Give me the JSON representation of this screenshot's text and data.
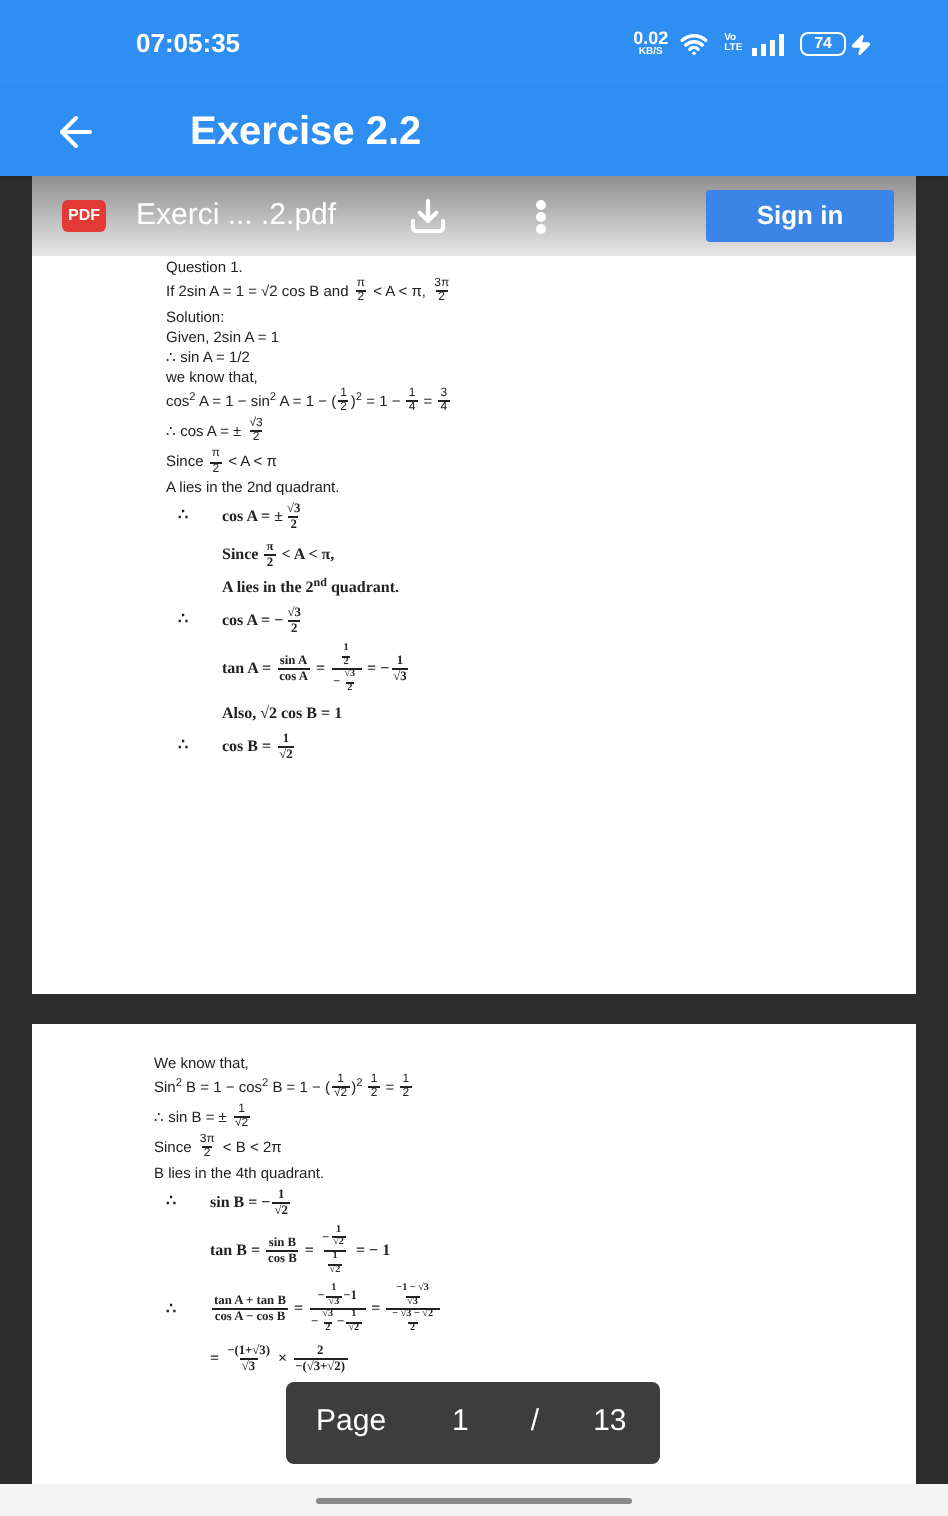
{
  "status_bar": {
    "time": "07:05:35",
    "speed": "0.02",
    "speed_unit": "KB/S",
    "network": "Vo LTE",
    "battery": "74",
    "charging": true
  },
  "app_bar": {
    "back": true,
    "title": "Exercise 2.2"
  },
  "viewer_toolbar": {
    "file_badge": "PDF",
    "file_name": "Exerci ... .2.pdf",
    "sign_in": "Sign in"
  },
  "pages": [
    {
      "lines": [
        {
          "kind": "sans",
          "parts": [
            {
              "kind": "text",
              "t": "Question 1."
            }
          ]
        },
        {
          "kind": "sans",
          "parts": [
            {
              "kind": "text",
              "t": "If 2sin A = 1 = √2 cos B and "
            },
            {
              "kind": "frac",
              "n": [
                {
                  "kind": "text",
                  "t": "π"
                }
              ],
              "d": [
                {
                  "kind": "text",
                  "t": "2"
                }
              ]
            },
            {
              "kind": "text",
              "t": " < A < π, "
            },
            {
              "kind": "frac",
              "n": [
                {
                  "kind": "text",
                  "t": "3π"
                }
              ],
              "d": [
                {
                  "kind": "text",
                  "t": "2"
                }
              ]
            }
          ]
        },
        {
          "kind": "sans",
          "parts": [
            {
              "kind": "text",
              "t": "Solution:"
            }
          ]
        },
        {
          "kind": "sans",
          "parts": [
            {
              "kind": "text",
              "t": "Given, 2sin A = 1"
            }
          ]
        },
        {
          "kind": "sans",
          "parts": [
            {
              "kind": "text",
              "t": "∴ sin A = 1/2"
            }
          ]
        },
        {
          "kind": "sans",
          "parts": [
            {
              "kind": "text",
              "t": "we know that,"
            }
          ]
        },
        {
          "kind": "sans",
          "parts": [
            {
              "kind": "text",
              "t": "cos$^{2}$ A = 1 − sin$^{2}$ A = 1 − ("
            },
            {
              "kind": "frac",
              "n": [
                {
                  "kind": "text",
                  "t": "1"
                }
              ],
              "d": [
                {
                  "kind": "text",
                  "t": "2"
                }
              ]
            },
            {
              "kind": "text",
              "t": ")$^{2}$ = 1 − "
            },
            {
              "kind": "frac",
              "n": [
                {
                  "kind": "text",
                  "t": "1"
                }
              ],
              "d": [
                {
                  "kind": "text",
                  "t": "4"
                }
              ]
            },
            {
              "kind": "text",
              "t": " = "
            },
            {
              "kind": "frac",
              "n": [
                {
                  "kind": "text",
                  "t": "3"
                }
              ],
              "d": [
                {
                  "kind": "text",
                  "t": "4"
                }
              ]
            }
          ]
        },
        {
          "kind": "sans",
          "parts": [
            {
              "kind": "text",
              "t": "∴ cos A = ± "
            },
            {
              "kind": "frac",
              "n": [
                {
                  "kind": "text",
                  "t": "√3"
                }
              ],
              "d": [
                {
                  "kind": "text",
                  "t": "2"
                }
              ]
            }
          ]
        },
        {
          "kind": "sans",
          "parts": [
            {
              "kind": "text",
              "t": "Since "
            },
            {
              "kind": "frac",
              "n": [
                {
                  "kind": "text",
                  "t": "π"
                }
              ],
              "d": [
                {
                  "kind": "text",
                  "t": "2"
                }
              ]
            },
            {
              "kind": "text",
              "t": " < A < π"
            }
          ]
        },
        {
          "kind": "sans",
          "parts": [
            {
              "kind": "text",
              "t": "A lies in the 2nd quadrant."
            }
          ]
        },
        {
          "kind": "serif",
          "therefore": "∴",
          "parts": [
            {
              "kind": "text",
              "t": "cos A = ±"
            },
            {
              "kind": "frac",
              "n": [
                {
                  "kind": "text",
                  "t": "√3"
                }
              ],
              "d": [
                {
                  "kind": "text",
                  "t": "2"
                }
              ]
            }
          ]
        },
        {
          "kind": "serif",
          "parts": [
            {
              "kind": "text",
              "t": "Since "
            },
            {
              "kind": "frac",
              "n": [
                {
                  "kind": "text",
                  "t": "π"
                }
              ],
              "d": [
                {
                  "kind": "text",
                  "t": "2"
                }
              ]
            },
            {
              "kind": "text",
              "t": " < A < π,"
            }
          ]
        },
        {
          "kind": "serif",
          "parts": [
            {
              "kind": "text",
              "t": "A lies in the 2$^{nd}$ quadrant."
            }
          ]
        },
        {
          "kind": "serif",
          "therefore": "∴",
          "parts": [
            {
              "kind": "text",
              "t": "cos A = −"
            },
            {
              "kind": "frac",
              "n": [
                {
                  "kind": "text",
                  "t": "√3"
                }
              ],
              "d": [
                {
                  "kind": "text",
                  "t": "2"
                }
              ]
            }
          ]
        },
        {
          "kind": "serif",
          "parts": [
            {
              "kind": "text",
              "t": "tan A = "
            },
            {
              "kind": "frac",
              "n": [
                {
                  "kind": "text",
                  "t": "sin A"
                }
              ],
              "d": [
                {
                  "kind": "text",
                  "t": "cos A"
                }
              ]
            },
            {
              "kind": "text",
              "t": " = "
            },
            {
              "kind": "frac",
              "n": [
                {
                  "kind": "frac",
                  "n": [
                    {
                      "kind": "text",
                      "t": "1"
                    }
                  ],
                  "d": [
                    {
                      "kind": "text",
                      "t": "2"
                    }
                  ]
                }
              ],
              "d": [
                {
                  "kind": "text",
                  "t": "−"
                },
                {
                  "kind": "frac",
                  "n": [
                    {
                      "kind": "text",
                      "t": "√3"
                    }
                  ],
                  "d": [
                    {
                      "kind": "text",
                      "t": "2"
                    }
                  ]
                }
              ]
            },
            {
              "kind": "text",
              "t": " = −"
            },
            {
              "kind": "frac",
              "n": [
                {
                  "kind": "text",
                  "t": "1"
                }
              ],
              "d": [
                {
                  "kind": "text",
                  "t": "√3"
                }
              ]
            }
          ]
        },
        {
          "kind": "serif",
          "parts": [
            {
              "kind": "text",
              "t": "Also, √2 cos B = 1"
            }
          ]
        },
        {
          "kind": "serif",
          "therefore": "∴",
          "parts": [
            {
              "kind": "text",
              "t": "cos B = "
            },
            {
              "kind": "frac",
              "n": [
                {
                  "kind": "text",
                  "t": "1"
                }
              ],
              "d": [
                {
                  "kind": "text",
                  "t": "√2"
                }
              ]
            }
          ]
        }
      ]
    },
    {
      "lines": [
        {
          "kind": "sans",
          "parts": [
            {
              "kind": "text",
              "t": "We know that,"
            }
          ]
        },
        {
          "kind": "sans",
          "parts": [
            {
              "kind": "text",
              "t": "Sin$^{2}$ B = 1 − cos$^{2}$ B = 1 − ("
            },
            {
              "kind": "frac",
              "n": [
                {
                  "kind": "text",
                  "t": "1"
                }
              ],
              "d": [
                {
                  "kind": "text",
                  "t": "√2"
                }
              ]
            },
            {
              "kind": "text",
              "t": ")$^{2}$ "
            },
            {
              "kind": "frac",
              "n": [
                {
                  "kind": "text",
                  "t": "1"
                }
              ],
              "d": [
                {
                  "kind": "text",
                  "t": "2"
                }
              ]
            },
            {
              "kind": "text",
              "t": " = "
            },
            {
              "kind": "frac",
              "n": [
                {
                  "kind": "text",
                  "t": "1"
                }
              ],
              "d": [
                {
                  "kind": "text",
                  "t": "2"
                }
              ]
            }
          ]
        },
        {
          "kind": "sans",
          "parts": [
            {
              "kind": "text",
              "t": "∴ sin B = ± "
            },
            {
              "kind": "frac",
              "n": [
                {
                  "kind": "text",
                  "t": "1"
                }
              ],
              "d": [
                {
                  "kind": "text",
                  "t": "√2"
                }
              ]
            }
          ]
        },
        {
          "kind": "sans",
          "parts": [
            {
              "kind": "text",
              "t": "Since "
            },
            {
              "kind": "frac",
              "n": [
                {
                  "kind": "text",
                  "t": "3π"
                }
              ],
              "d": [
                {
                  "kind": "text",
                  "t": "2"
                }
              ]
            },
            {
              "kind": "text",
              "t": " < B < 2π"
            }
          ]
        },
        {
          "kind": "sans",
          "parts": [
            {
              "kind": "text",
              "t": "B lies in the 4th quadrant."
            }
          ]
        },
        {
          "kind": "serif",
          "therefore": "∴",
          "parts": [
            {
              "kind": "text",
              "t": "sin B = −"
            },
            {
              "kind": "frac",
              "n": [
                {
                  "kind": "text",
                  "t": "1"
                }
              ],
              "d": [
                {
                  "kind": "text",
                  "t": "√2"
                }
              ]
            }
          ]
        },
        {
          "kind": "serif",
          "parts": [
            {
              "kind": "text",
              "t": "tan B = "
            },
            {
              "kind": "frac",
              "n": [
                {
                  "kind": "text",
                  "t": "sin B"
                }
              ],
              "d": [
                {
                  "kind": "text",
                  "t": "cos B"
                }
              ]
            },
            {
              "kind": "text",
              "t": " = "
            },
            {
              "kind": "frac",
              "n": [
                {
                  "kind": "text",
                  "t": "−"
                },
                {
                  "kind": "frac",
                  "n": [
                    {
                      "kind": "text",
                      "t": "1"
                    }
                  ],
                  "d": [
                    {
                      "kind": "text",
                      "t": "√2"
                    }
                  ]
                }
              ],
              "d": [
                {
                  "kind": "frac",
                  "n": [
                    {
                      "kind": "text",
                      "t": "1"
                    }
                  ],
                  "d": [
                    {
                      "kind": "text",
                      "t": "√2"
                    }
                  ]
                }
              ]
            },
            {
              "kind": "text",
              "t": " = − 1"
            }
          ]
        },
        {
          "kind": "serif",
          "therefore": "∴",
          "parts": [
            {
              "kind": "frac",
              "n": [
                {
                  "kind": "text",
                  "t": "tan A + tan B"
                }
              ],
              "d": [
                {
                  "kind": "text",
                  "t": "cos A − cos B"
                }
              ]
            },
            {
              "kind": "text",
              "t": " = "
            },
            {
              "kind": "frac",
              "n": [
                {
                  "kind": "text",
                  "t": "−"
                },
                {
                  "kind": "frac",
                  "n": [
                    {
                      "kind": "text",
                      "t": "1"
                    }
                  ],
                  "d": [
                    {
                      "kind": "text",
                      "t": "√3"
                    }
                  ]
                },
                {
                  "kind": "text",
                  "t": "−1"
                }
              ],
              "d": [
                {
                  "kind": "text",
                  "t": "−"
                },
                {
                  "kind": "frac",
                  "n": [
                    {
                      "kind": "text",
                      "t": "√3"
                    }
                  ],
                  "d": [
                    {
                      "kind": "text",
                      "t": "2"
                    }
                  ]
                },
                {
                  "kind": "text",
                  "t": "−"
                },
                {
                  "kind": "frac",
                  "n": [
                    {
                      "kind": "text",
                      "t": "1"
                    }
                  ],
                  "d": [
                    {
                      "kind": "text",
                      "t": "√2"
                    }
                  ]
                }
              ]
            },
            {
              "kind": "text",
              "t": " = "
            },
            {
              "kind": "frac",
              "n": [
                {
                  "kind": "frac",
                  "n": [
                    {
                      "kind": "text",
                      "t": "−1 − √3"
                    }
                  ],
                  "d": [
                    {
                      "kind": "text",
                      "t": "√3"
                    }
                  ]
                }
              ],
              "d": [
                {
                  "kind": "frac",
                  "n": [
                    {
                      "kind": "text",
                      "t": "− √3 − √2"
                    }
                  ],
                  "d": [
                    {
                      "kind": "text",
                      "t": "2"
                    }
                  ]
                }
              ]
            }
          ]
        },
        {
          "kind": "serif",
          "parts": [
            {
              "kind": "text",
              "t": "= "
            },
            {
              "kind": "frac",
              "n": [
                {
                  "kind": "text",
                  "t": "−(1+√3)"
                }
              ],
              "d": [
                {
                  "kind": "text",
                  "t": "√3"
                }
              ]
            },
            {
              "kind": "text",
              "t": " × "
            },
            {
              "kind": "frac",
              "n": [
                {
                  "kind": "text",
                  "t": "2"
                }
              ],
              "d": [
                {
                  "kind": "text",
                  "t": "−(√3+√2)"
                }
              ]
            }
          ]
        }
      ]
    }
  ],
  "page_indicator": {
    "label": "Page",
    "current": "1",
    "separator": "/",
    "total": "13"
  }
}
